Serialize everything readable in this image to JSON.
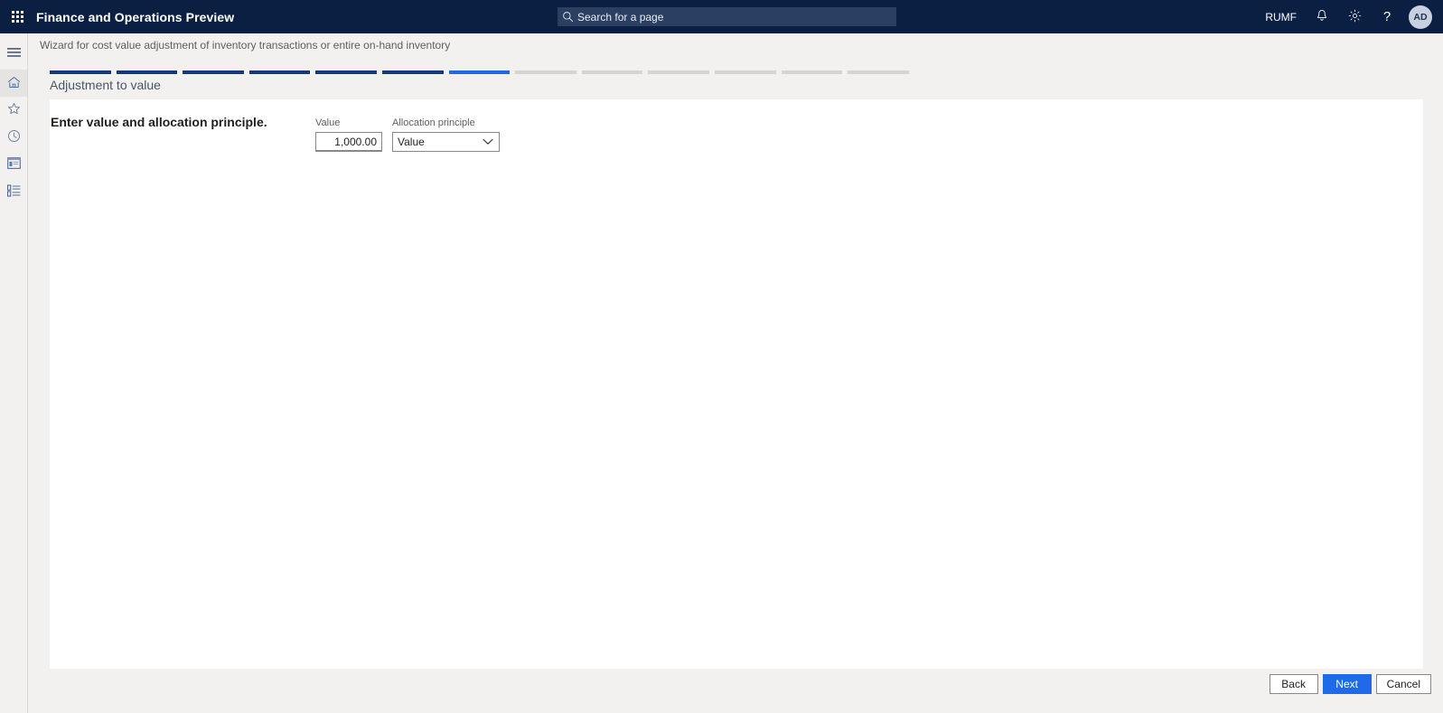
{
  "topbar": {
    "waffle_icon": "app-launcher-icon",
    "app_title": "Finance and Operations Preview",
    "search": {
      "icon": "search-icon",
      "placeholder": "Search for a page"
    },
    "company_id": "RUMF",
    "notifications_icon": "bell-icon",
    "settings_icon": "gear-icon",
    "help_icon": "question-mark-icon",
    "avatar_initials": "AD",
    "background_color": "#0b1f42",
    "search_background_color": "#2b3f63"
  },
  "rail": {
    "items": [
      {
        "name": "hamburger-menu",
        "icon": "hamburger-icon",
        "active": false
      },
      {
        "name": "home",
        "icon": "home-icon",
        "active": true
      },
      {
        "name": "favorites",
        "icon": "star-icon",
        "active": false
      },
      {
        "name": "recent",
        "icon": "clock-icon",
        "active": false
      },
      {
        "name": "workspaces",
        "icon": "workspace-window-icon",
        "active": false
      },
      {
        "name": "modules",
        "icon": "list-modules-icon",
        "active": false
      }
    ]
  },
  "page": {
    "caption": "Wizard for cost value adjustment of inventory transactions or entire on-hand inventory"
  },
  "wizard": {
    "subtitle": "Adjustment to value",
    "total_steps": 13,
    "current_step": 7,
    "completed_steps": 6,
    "colors": {
      "done": "#123a7a",
      "current": "#1f6ae8",
      "pending": "#d6d4d2"
    }
  },
  "form": {
    "prompt": "Enter value and allocation principle.",
    "fields": [
      {
        "name": "value",
        "label": "Value",
        "type": "text",
        "value": "1,000.00"
      },
      {
        "name": "allocation-principle",
        "label": "Allocation principle",
        "type": "select",
        "value": "Value",
        "chevron_icon": "chevron-down-icon"
      }
    ]
  },
  "footer": {
    "buttons": [
      {
        "name": "back",
        "label": "Back",
        "primary": false
      },
      {
        "name": "next",
        "label": "Next",
        "primary": true
      },
      {
        "name": "cancel",
        "label": "Cancel",
        "primary": false
      }
    ]
  }
}
